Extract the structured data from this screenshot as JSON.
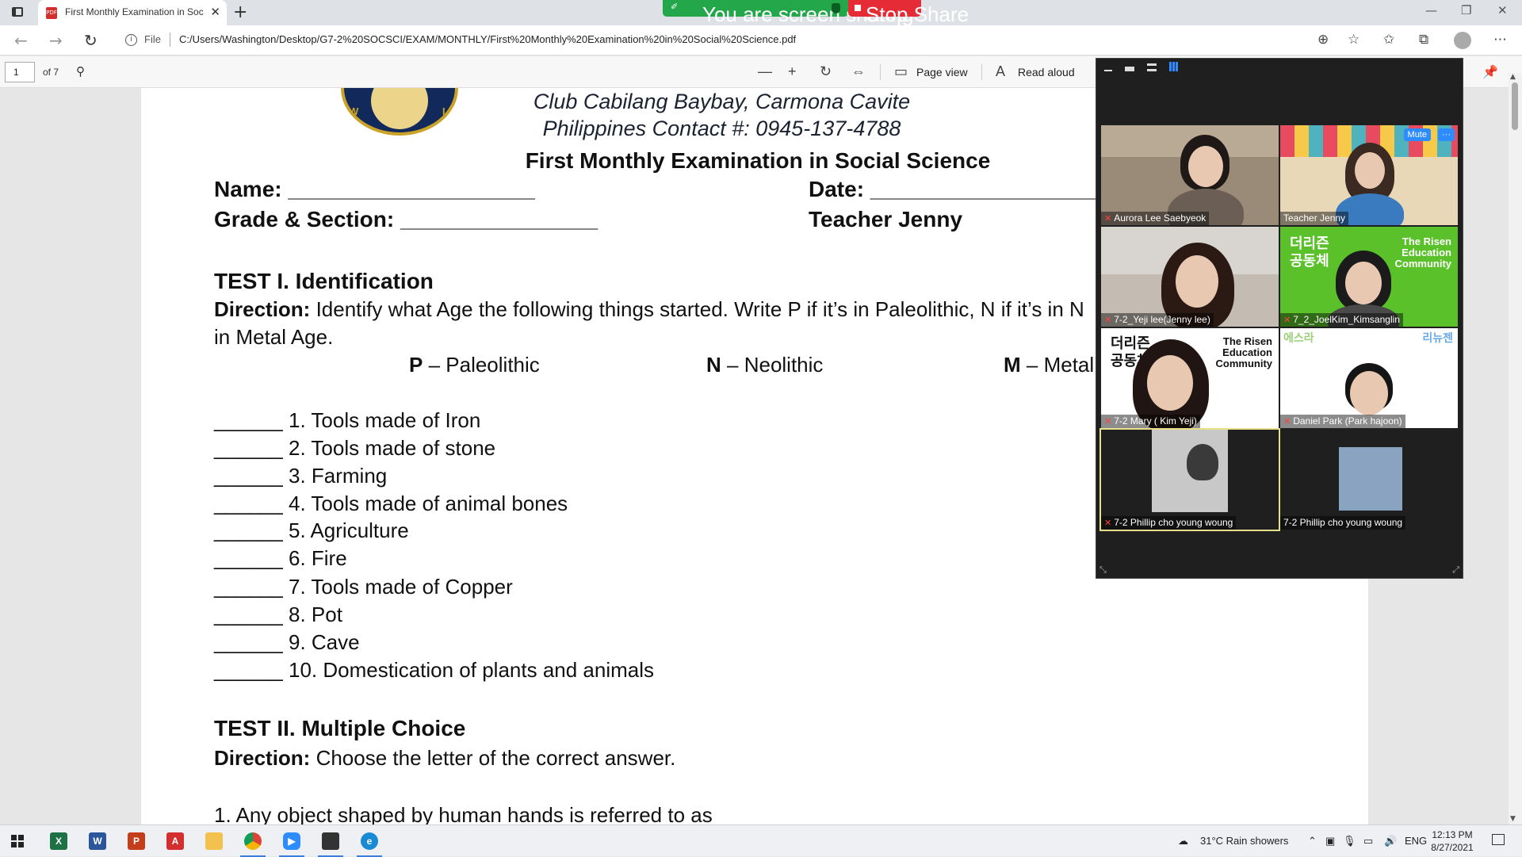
{
  "browser": {
    "tab_title": "First Monthly Examination in Soc",
    "file_label": "File",
    "url": "C:/Users/Washington/Desktop/G7-2%20SOCSCI/EXAM/MONTHLY/First%20Monthly%20Examination%20in%20Social%20Science.pdf"
  },
  "screen_share": {
    "status": "You are screen sharing",
    "stop_label": "Stop Share"
  },
  "pdf_toolbar": {
    "page_number": "1",
    "page_total": "of 7",
    "page_view_label": "Page view",
    "read_aloud_label": "Read aloud"
  },
  "document": {
    "club_line1": "Club Cabilang Baybay, Carmona Cavite",
    "club_line2": "Philippines Contact #: 0945-137-4788",
    "exam_title": "First Monthly Examination in Social Science",
    "name_field": "Name: ____________________",
    "date_field": "Date: ____________________",
    "grade_field": "Grade & Section: ________________",
    "teacher": "Teacher Jenny",
    "test1": {
      "heading": "TEST I. Identification",
      "direction_label": "Direction:",
      "direction_line1": " Identify what Age the following things started. Write P if it’s in Paleolithic, N if it’s in N",
      "direction_line2": "in Metal Age.",
      "legend": [
        {
          "key": "P",
          "dash": " – ",
          "value": "Paleolithic"
        },
        {
          "key": "N",
          "dash": " – ",
          "value": "Neolithic"
        },
        {
          "key": "M",
          "dash": " – ",
          "value": "Metal"
        }
      ],
      "items": [
        "______ 1. Tools made of Iron",
        "______ 2. Tools made of stone",
        "______ 3. Farming",
        "______ 4. Tools made of animal bones",
        "______ 5. Agriculture",
        "______ 6. Fire",
        "______ 7. Tools made of Copper",
        "______ 8. Pot",
        "______ 9. Cave",
        "______ 10. Domestication of plants and animals"
      ]
    },
    "test2": {
      "heading": "TEST II. Multiple Choice",
      "direction_label": "Direction:",
      "direction_text": " Choose the letter of the correct answer.",
      "q1": "1. Any object shaped by human hands is referred to as"
    }
  },
  "zoom": {
    "participants": [
      {
        "name": "Aurora Lee Saebyeok"
      },
      {
        "name": "Teacher Jenny"
      },
      {
        "name": "7-2_Yeji lee(Jenny lee)"
      },
      {
        "name": "7_2_JoelKim_Kimsanglin"
      },
      {
        "name": "7-2 Mary ( Kim Yeji)"
      },
      {
        "name": "Daniel Park (Park hajoon)"
      },
      {
        "name": "7-2 Phillip cho young woung"
      },
      {
        "name": "7-2 Phillip cho young woung"
      }
    ],
    "mute_label": "Mute",
    "more_label": "···",
    "logo_kr_1": "더리즌",
    "logo_kr_2": "공동체",
    "logo_en_1": "The Risen",
    "logo_en_2": "Education",
    "logo_en_3": "Community",
    "banner_kr_1": "에스라",
    "banner_kr_2": "리뉴젠"
  },
  "taskbar": {
    "weather": "31°C  Rain showers",
    "lang": "ENG",
    "time": "12:13 PM",
    "date": "8/27/2021"
  }
}
